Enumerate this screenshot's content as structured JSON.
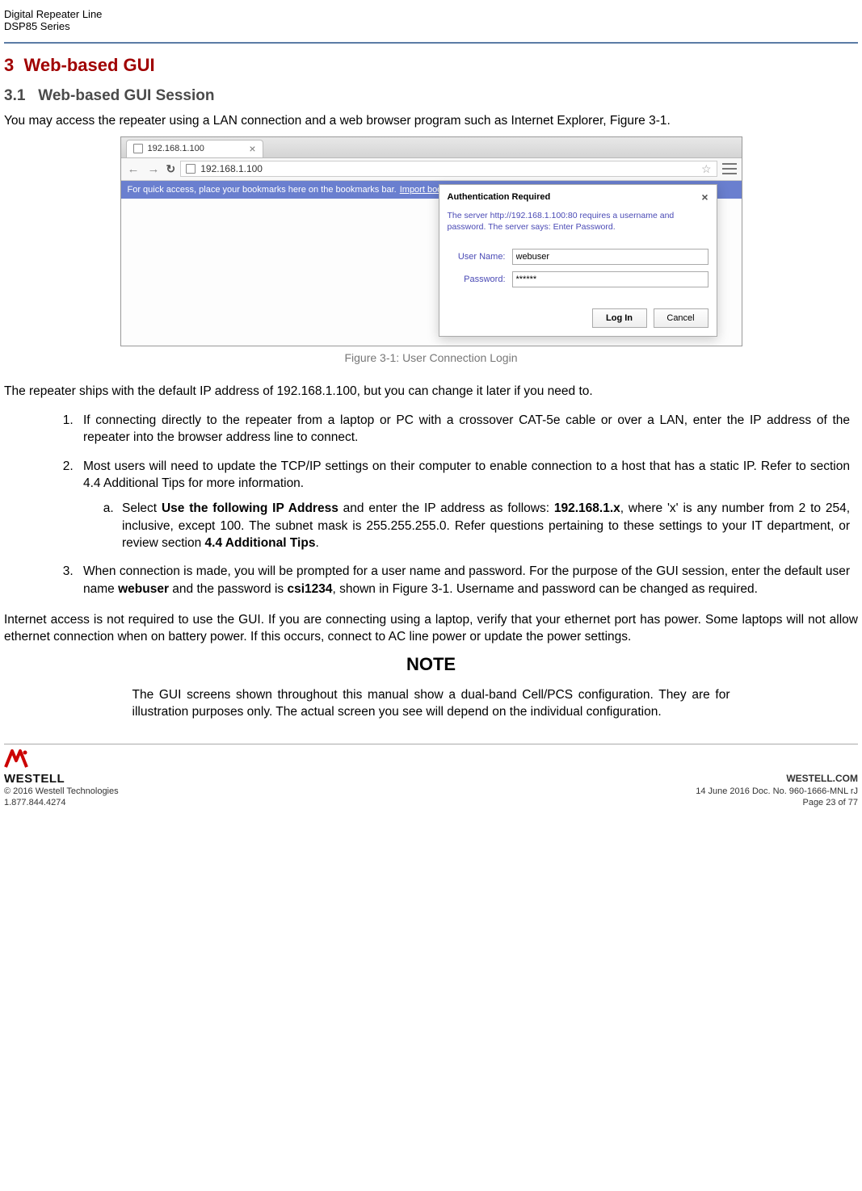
{
  "header": {
    "line1": "Digital Repeater Line",
    "line2": "DSP85 Series"
  },
  "section": {
    "h1_num": "3",
    "h1_title": "Web-based GUI",
    "h2_num": "3.1",
    "h2_title": "Web-based GUI Session",
    "intro": "You may access the repeater using a LAN connection and a web browser program such as Internet Explorer, Figure 3-1."
  },
  "browser": {
    "tab_title": "192.168.1.100",
    "url": "192.168.1.100",
    "bookmarks_text": "For quick access, place your bookmarks here on the bookmarks bar.",
    "bookmarks_link": "Import bookmarks now...",
    "auth": {
      "title": "Authentication Required",
      "msg": "The server http://192.168.1.100:80 requires a username and password. The server says: Enter Password.",
      "username_label": "User Name:",
      "username_value": "webuser",
      "password_label": "Password:",
      "password_value": "******",
      "login_btn": "Log In",
      "cancel_btn": "Cancel"
    }
  },
  "figure_caption": "Figure 3-1: User Connection Login",
  "para_after_fig": "The repeater ships with the default IP address of 192.168.1.100, but you can change it later if you need to.",
  "list": {
    "item1": "If connecting directly to the repeater from a laptop or PC with a crossover CAT-5e cable or over a LAN, enter the IP address of the repeater into the browser address line to connect.",
    "item2": "Most users will need to update the TCP/IP settings on their computer to enable connection to a host that has a static IP.  Refer to section 4.4 Additional Tips for more information.",
    "item2a_pre": "Select ",
    "item2a_b1": "Use the following IP Address",
    "item2a_mid1": " and enter the IP address as follows: ",
    "item2a_b2": "192.168.1.x",
    "item2a_mid2": ", where 'x' is any number from 2 to 254, inclusive, except 100.  The subnet mask is 255.255.255.0.  Refer questions pertaining to these settings to your IT department, or review section ",
    "item2a_b3": "4.4 Additional Tips",
    "item2a_end": ".",
    "item3_pre": "When connection is made, you will be prompted for a user name and password.  For the purpose of the GUI session, enter the default user name ",
    "item3_b1": "webuser",
    "item3_mid": " and the password is ",
    "item3_b2": "csi1234",
    "item3_end": ", shown in Figure 3-1.  Username and password can be changed as required."
  },
  "para_internet": "Internet access is not required to use the GUI.  If you are connecting using a laptop, verify that your ethernet port has power.  Some laptops will not allow ethernet connection when on battery power.  If this occurs, connect to AC line power or update the power settings.",
  "note": {
    "title": "NOTE",
    "body": "The GUI screens shown throughout this manual show a dual-band Cell/PCS configuration. They are for illustration purposes only. The actual screen you see will depend on the individual configuration."
  },
  "footer": {
    "logo_text": "WESTELL",
    "copyright": "© 2016 Westell Technologies",
    "phone": "1.877.844.4274",
    "site": "WESTELL.COM",
    "docinfo": "14 June 2016 Doc. No. 960-1666-MNL rJ",
    "page": "Page 23 of 77"
  }
}
